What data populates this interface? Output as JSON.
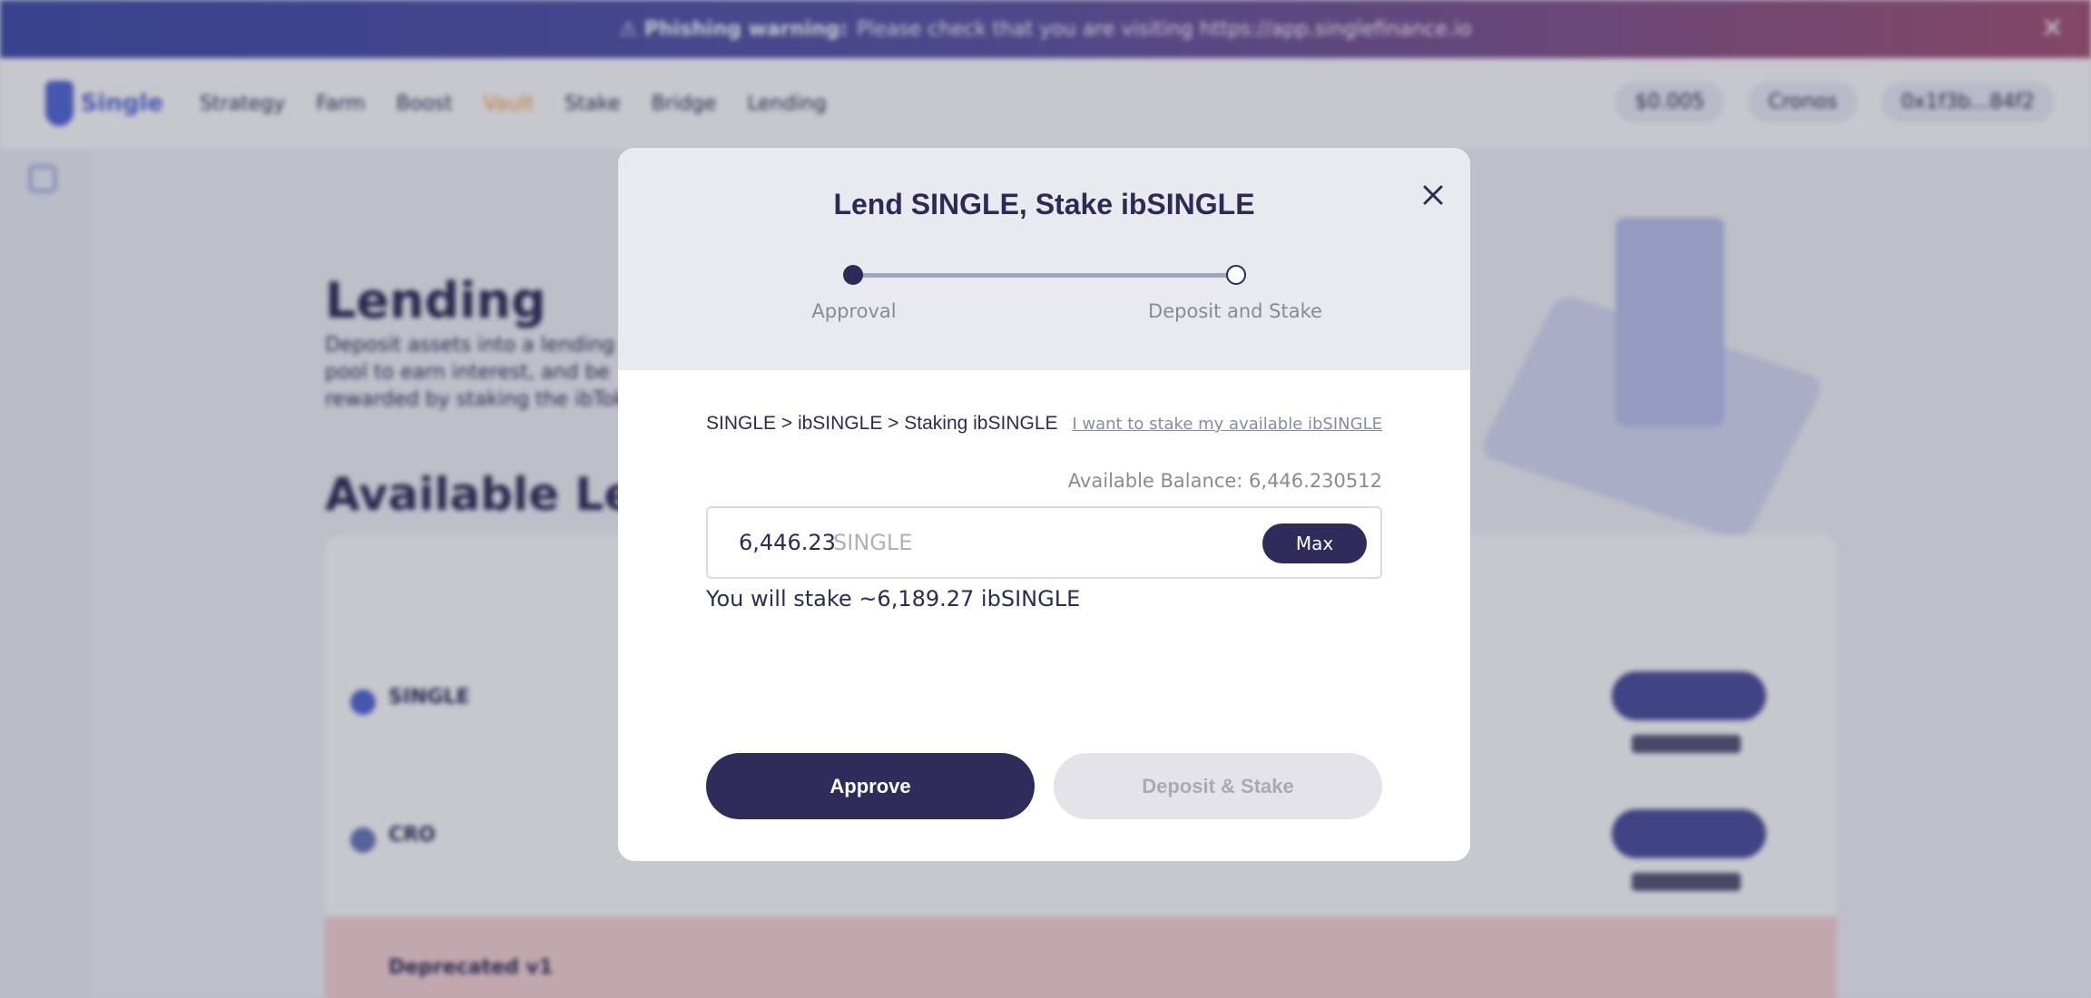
{
  "banner": {
    "warning": "⚠ Phishing warning:",
    "message": "Please check that you are visiting https://app.singlefinance.io",
    "close": "✕"
  },
  "nav": {
    "logo_text": "Single",
    "items": [
      "Strategy",
      "Farm",
      "Boost",
      "Vault",
      "Stake",
      "Bridge",
      "Lending"
    ],
    "active_index": 3,
    "right": {
      "price": "$0.005",
      "network": "Cronos",
      "wallet": "0x1f3b...84f2"
    }
  },
  "page": {
    "heading": "Lending",
    "description": "Deposit assets into a lending pool to earn interest, and be rewarded by staking the ibToken",
    "available_heading": "Available Lending Pools",
    "rows": [
      {
        "coin": "SINGLE",
        "highlight": false
      },
      {
        "coin": "CRO",
        "highlight": false
      },
      {
        "coin": "Deprecated v1",
        "highlight": true
      }
    ]
  },
  "modal": {
    "title": "Lend SINGLE, Stake ibSINGLE",
    "steps": [
      {
        "label": "Approval",
        "done": true
      },
      {
        "label": "Deposit and Stake",
        "done": false
      }
    ],
    "route": "SINGLE > ibSINGLE > Staking ibSINGLE",
    "stake_available_link": "I want to stake my available ibSINGLE",
    "balance_label": "Available Balance: 6,446.230512",
    "amount": {
      "value": "6,446.23",
      "unit": "SINGLE"
    },
    "max_label": "Max",
    "stake_estimate": "You will stake ~6,189.27 ibSINGLE",
    "approve_label": "Approve",
    "deposit_label": "Deposit & Stake"
  }
}
